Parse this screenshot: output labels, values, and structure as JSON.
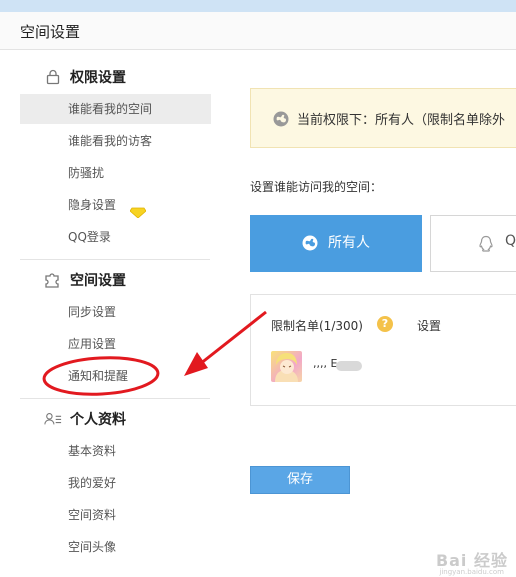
{
  "header": {
    "title": "空间设置"
  },
  "sidebar": {
    "sections": [
      {
        "label": "权限设置",
        "icon": "lock-icon",
        "items": [
          "谁能看我的空间",
          "谁能看我的访客",
          "防骚扰",
          "隐身设置",
          "QQ登录"
        ]
      },
      {
        "label": "空间设置",
        "icon": "puzzle-icon",
        "items": [
          "同步设置",
          "应用设置",
          "通知和提醒"
        ]
      },
      {
        "label": "个人资料",
        "icon": "profile-card-icon",
        "items": [
          "基本资料",
          "我的爱好",
          "空间资料",
          "空间头像"
        ]
      }
    ],
    "active_item": "谁能看我的空间"
  },
  "main": {
    "notice": "当前权限下：所有人（限制名单除外",
    "question": "设置谁能访问我的空间：",
    "options": [
      {
        "label": "所有人",
        "icon": "globe-icon",
        "selected": true
      },
      {
        "label": "Q",
        "icon": "qq-penguin-icon",
        "selected": false
      }
    ],
    "restricted": {
      "title": "限制名单(1/300)",
      "help": "?",
      "set_label": "设置",
      "user": ",,,, E"
    },
    "save_label": "保存"
  },
  "watermark": {
    "text": "Bai 经验",
    "sub": "jingyan.baidu.com"
  },
  "colors": {
    "accent": "#4a9de0",
    "annotation": "#e2191f",
    "notice_bg": "#fdf8e2"
  }
}
